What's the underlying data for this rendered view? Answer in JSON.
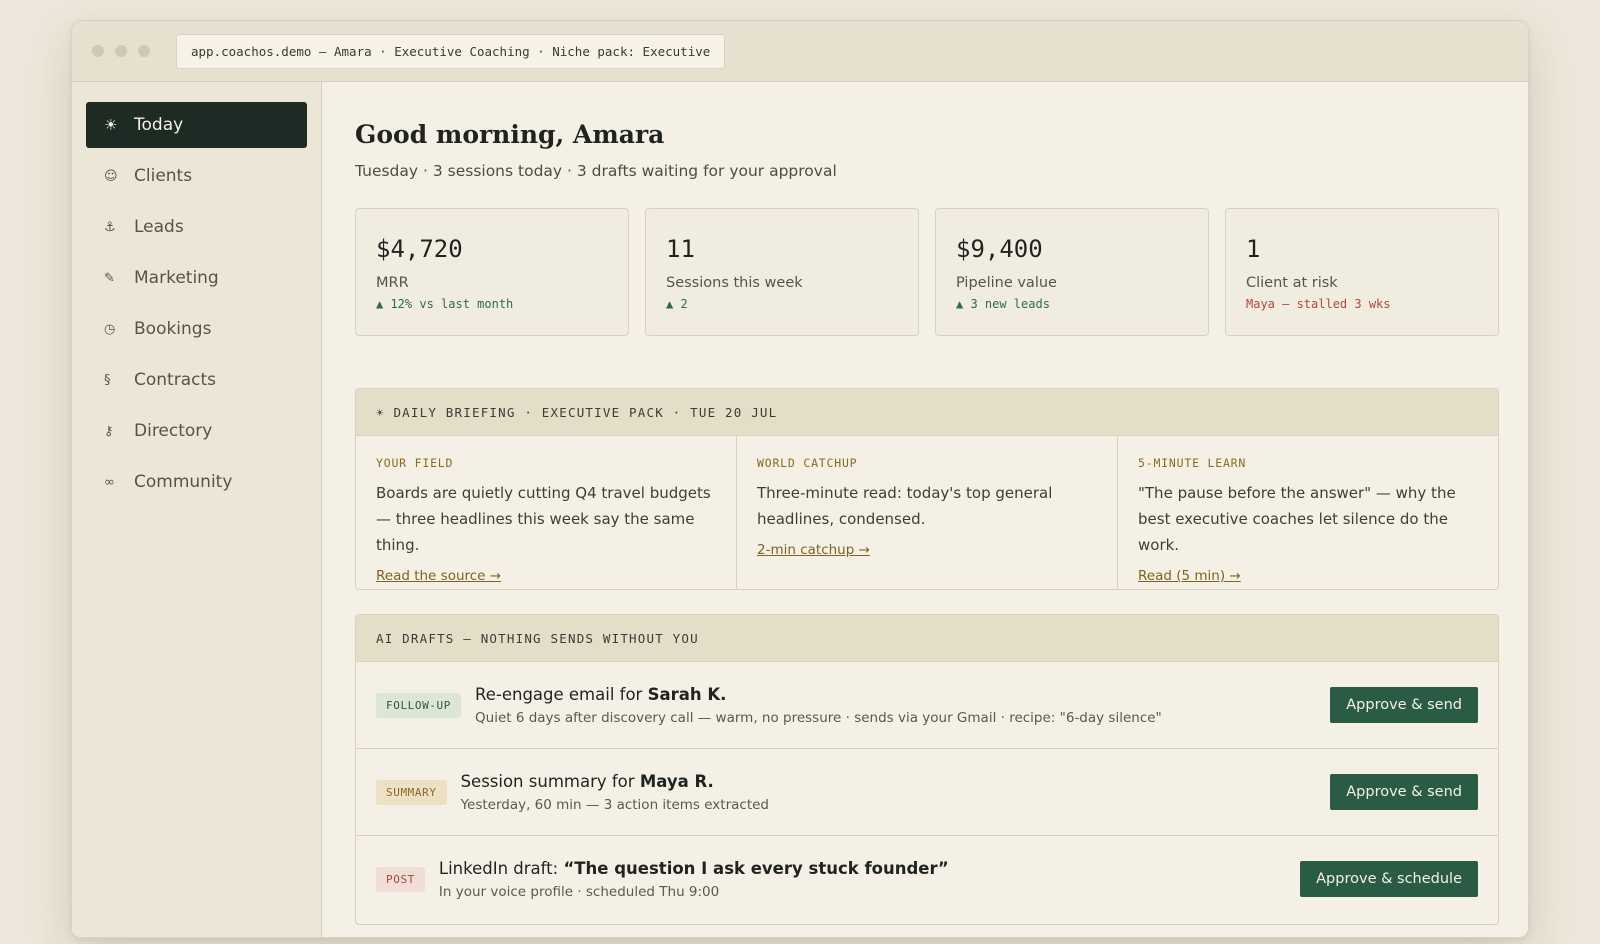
{
  "window": {
    "url": "app.coachos.demo — Amara · Executive Coaching · Niche pack: Executive"
  },
  "sidebar": {
    "items": [
      {
        "label": "Today",
        "icon": "sun-icon",
        "glyph": "☀"
      },
      {
        "label": "Clients",
        "icon": "people-icon",
        "glyph": "☺"
      },
      {
        "label": "Leads",
        "icon": "anchor-icon",
        "glyph": "⚓"
      },
      {
        "label": "Marketing",
        "icon": "pen-icon",
        "glyph": "✎"
      },
      {
        "label": "Bookings",
        "icon": "clock-icon",
        "glyph": "◷"
      },
      {
        "label": "Contracts",
        "icon": "section-icon",
        "glyph": "§"
      },
      {
        "label": "Directory",
        "icon": "key-icon",
        "glyph": "⚷"
      },
      {
        "label": "Community",
        "icon": "link-icon",
        "glyph": "∞"
      }
    ]
  },
  "header": {
    "greeting": "Good morning, Amara",
    "subline": "Tuesday · 3 sessions today · 3 drafts waiting for your approval"
  },
  "stats": [
    {
      "value": "$4,720",
      "label": "MRR",
      "delta": "▲ 12% vs last month"
    },
    {
      "value": "11",
      "label": "Sessions this week",
      "delta": "▲ 2"
    },
    {
      "value": "$9,400",
      "label": "Pipeline value",
      "delta": "▲ 3 new leads"
    },
    {
      "value": "1",
      "label": "Client at risk",
      "delta": "Maya — stalled 3 wks"
    }
  ],
  "briefing": {
    "title": "☀ DAILY BRIEFING · EXECUTIVE PACK · TUE 20 JUL",
    "columns": [
      {
        "tag": "YOUR FIELD",
        "text": "Boards are quietly cutting Q4 travel budgets — three headlines this week say the same thing.",
        "link": "Read the source →"
      },
      {
        "tag": "WORLD CATCHUP",
        "text": "Three-minute read: today's top general headlines, condensed.",
        "link": "2-min catchup →"
      },
      {
        "tag": "5-MINUTE LEARN",
        "text": "\"The pause before the answer\" — why the best executive coaches let silence do the work.",
        "link": "Read (5 min) →"
      }
    ]
  },
  "drafts": {
    "title": "AI DRAFTS — NOTHING SENDS WITHOUT YOU",
    "rows": [
      {
        "badge": "FOLLOW-UP",
        "prefix": "Re-engage email for ",
        "name": "Sarah K.",
        "detail": "Quiet 6 days after discovery call — warm, no pressure · sends via your Gmail · recipe: \"6-day silence\"",
        "action": "Approve & send"
      },
      {
        "badge": "SUMMARY",
        "prefix": "Session summary for ",
        "name": "Maya R.",
        "detail": "Yesterday, 60 min — 3 action items extracted",
        "action": "Approve & send"
      },
      {
        "badge": "POST",
        "prefix": "LinkedIn draft: ",
        "name": "“The question I ask every stuck founder”",
        "detail": "In your voice profile · scheduled Thu 9:00",
        "action": "Approve & schedule"
      }
    ]
  }
}
